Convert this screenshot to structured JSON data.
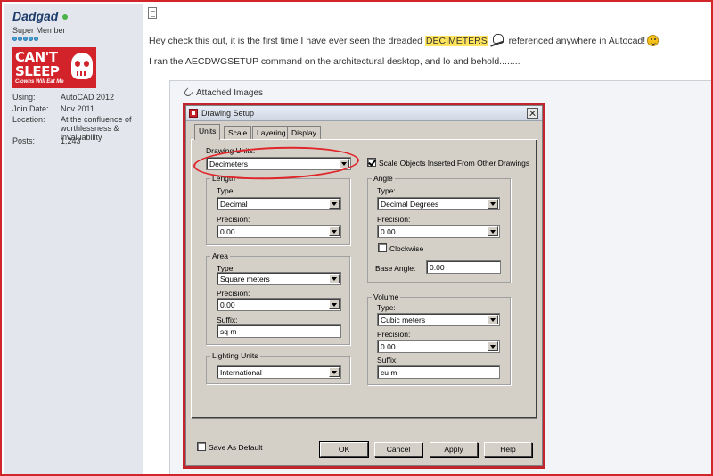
{
  "sidebar": {
    "username": "Dadgad",
    "user_title": "Super Member",
    "avatar": {
      "line1": "CAN'T",
      "line2": "SLEEP",
      "line3": "Clowns Will Eat Me"
    },
    "info": [
      {
        "label": "Using:",
        "value": "AutoCAD 2012"
      },
      {
        "label": "Join Date:",
        "value": "Nov 2011"
      },
      {
        "label": "Location:",
        "value": "At the confluence of worthlessness & invaluability"
      },
      {
        "label": "Posts:",
        "value": "1,243"
      }
    ]
  },
  "post": {
    "line1_before": "Hey check this out, it is the first time I have ever seen the dreaded ",
    "line1_highlight": "DECIMETERS",
    "line1_after": " referenced anywhere in Autocad!",
    "line2": "I ran the AECDWGSETUP command on the architectural desktop, and lo and behold........",
    "attached_title": "Attached Images"
  },
  "dialog": {
    "title": "Drawing Setup",
    "tabs": [
      "Units",
      "Scale",
      "Layering",
      "Display"
    ],
    "drawing_units_label": "Drawing Units:",
    "drawing_units_value": "Decimeters",
    "scale_objects_label": "Scale Objects Inserted From Other Drawings",
    "length": {
      "title": "Length",
      "type_label": "Type:",
      "type_value": "Decimal",
      "precision_label": "Precision:",
      "precision_value": "0.00"
    },
    "area": {
      "title": "Area",
      "type_label": "Type:",
      "type_value": "Square meters",
      "precision_label": "Precision:",
      "precision_value": "0.00",
      "suffix_label": "Suffix:",
      "suffix_value": "sq m"
    },
    "lighting": {
      "title": "Lighting Units",
      "value": "International"
    },
    "angle": {
      "title": "Angle",
      "type_label": "Type:",
      "type_value": "Decimal Degrees",
      "precision_label": "Precision:",
      "precision_value": "0.00",
      "clockwise_label": "Clockwise",
      "base_angle_label": "Base Angle:",
      "base_angle_value": "0.00"
    },
    "volume": {
      "title": "Volume",
      "type_label": "Type:",
      "type_value": "Cubic meters",
      "precision_label": "Precision:",
      "precision_value": "0.00",
      "suffix_label": "Suffix:",
      "suffix_value": "cu m"
    },
    "save_default_label": "Save As Default",
    "buttons": {
      "ok": "OK",
      "cancel": "Cancel",
      "apply": "Apply",
      "help": "Help"
    }
  },
  "colors": {
    "frame_red": "#d2252a",
    "highlight": "#ffe45c",
    "sidebar_bg": "#e3e7ed",
    "dialog_bg": "#d4d0c8"
  }
}
